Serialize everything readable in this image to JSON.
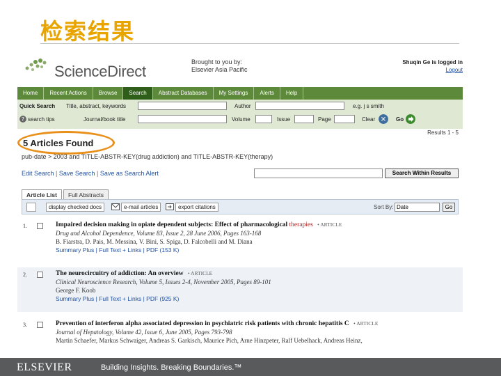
{
  "slide": {
    "title": "检索结果"
  },
  "header": {
    "logo_text": "ScienceDirect",
    "brought_line1": "Brought to you by:",
    "brought_line2": "Elsevier Asia Pacific",
    "logged_in": "Shuqin Ge is logged in",
    "logout": "Logout"
  },
  "nav": {
    "items": [
      {
        "label": "Home"
      },
      {
        "label": "Recent Actions"
      },
      {
        "label": "Browse"
      },
      {
        "label": "Search"
      },
      {
        "label": "Abstract Databases"
      },
      {
        "label": "My Settings"
      },
      {
        "label": "Alerts"
      },
      {
        "label": "Help"
      }
    ]
  },
  "quick_search": {
    "label": "Quick Search",
    "title_abstract_keywords": "Title, abstract, keywords",
    "author": "Author",
    "eg": "e.g. j s smith",
    "search_tips": "search tips",
    "journal_book_title": "Journal/book title",
    "volume": "Volume",
    "issue": "Issue",
    "page": "Page",
    "clear": "Clear",
    "go": "Go"
  },
  "results": {
    "count_label": "Results 1 - 5",
    "found_label": "5 Articles Found",
    "query": "pub-date > 2003 and TITLE-ABSTR-KEY(drug addiction) and TITLE-ABSTR-KEY(therapy)",
    "edit_search": "Edit Search",
    "save_search": "Save Search",
    "save_alert": "Save as Search Alert",
    "sep": "|",
    "within_btn": "Search Within Results"
  },
  "tabs": {
    "article_list": "Article List",
    "full_abstracts": "Full Abstracts"
  },
  "toolbar": {
    "display_checked": "display checked docs",
    "email_articles": "e-mail articles",
    "export_citations": "export citations",
    "sort_by": "Sort By:",
    "sort_value": "Date",
    "go": "Go"
  },
  "articles": [
    {
      "num": "1.",
      "title": "Impaired decision making in opiate dependent subjects: Effect of pharmacological",
      "title_hl": "therapies",
      "badge": "• ARTICLE",
      "journal": "Drug and Alcohol Dependence, Volume 83, Issue 2, 28 June 2006, Pages 163-168",
      "authors": "B. Fiarstra, D. Pais, M. Messina, V. Bini, S. Spiga, D. Falcobelli and M. Diana",
      "links": "Summary Plus | Full Text + Links | PDF (153 K)"
    },
    {
      "num": "2.",
      "title": "The neurocircuitry of addiction: An overview",
      "title_hl": "",
      "badge": "• ARTICLE",
      "journal": "Clinical Neuroscience Research, Volume 5, Issues 2-4, November 2005, Pages 89-101",
      "authors": "George F. Koob",
      "links": "Summary Plus | Full Text + Links | PDF (925 K)"
    },
    {
      "num": "3.",
      "title": "Prevention of interferon alpha associated depression in psychiatric risk patients with chronic hepatitis C",
      "title_hl": "",
      "badge": "• ARTICLE",
      "journal": "Journal of Hepatology, Volume 42, Issue 6, June 2005, Pages 793-798",
      "authors": "Martin Schaefer, Markus Schwaiger, Andreas S. Garkisch, Maurice Pich, Arne Hinzpeter, Ralf Uebelhack, Andreas Heinz,",
      "links": ""
    }
  ],
  "footer": {
    "brand": "ELSEVIER",
    "tagline": "Building Insights. Breaking Boundaries.™"
  },
  "colors": {
    "title": "#e8a400",
    "nav": "#5d8a3a",
    "highlight_circle": "#e8901a",
    "footer": "#585a5c"
  }
}
